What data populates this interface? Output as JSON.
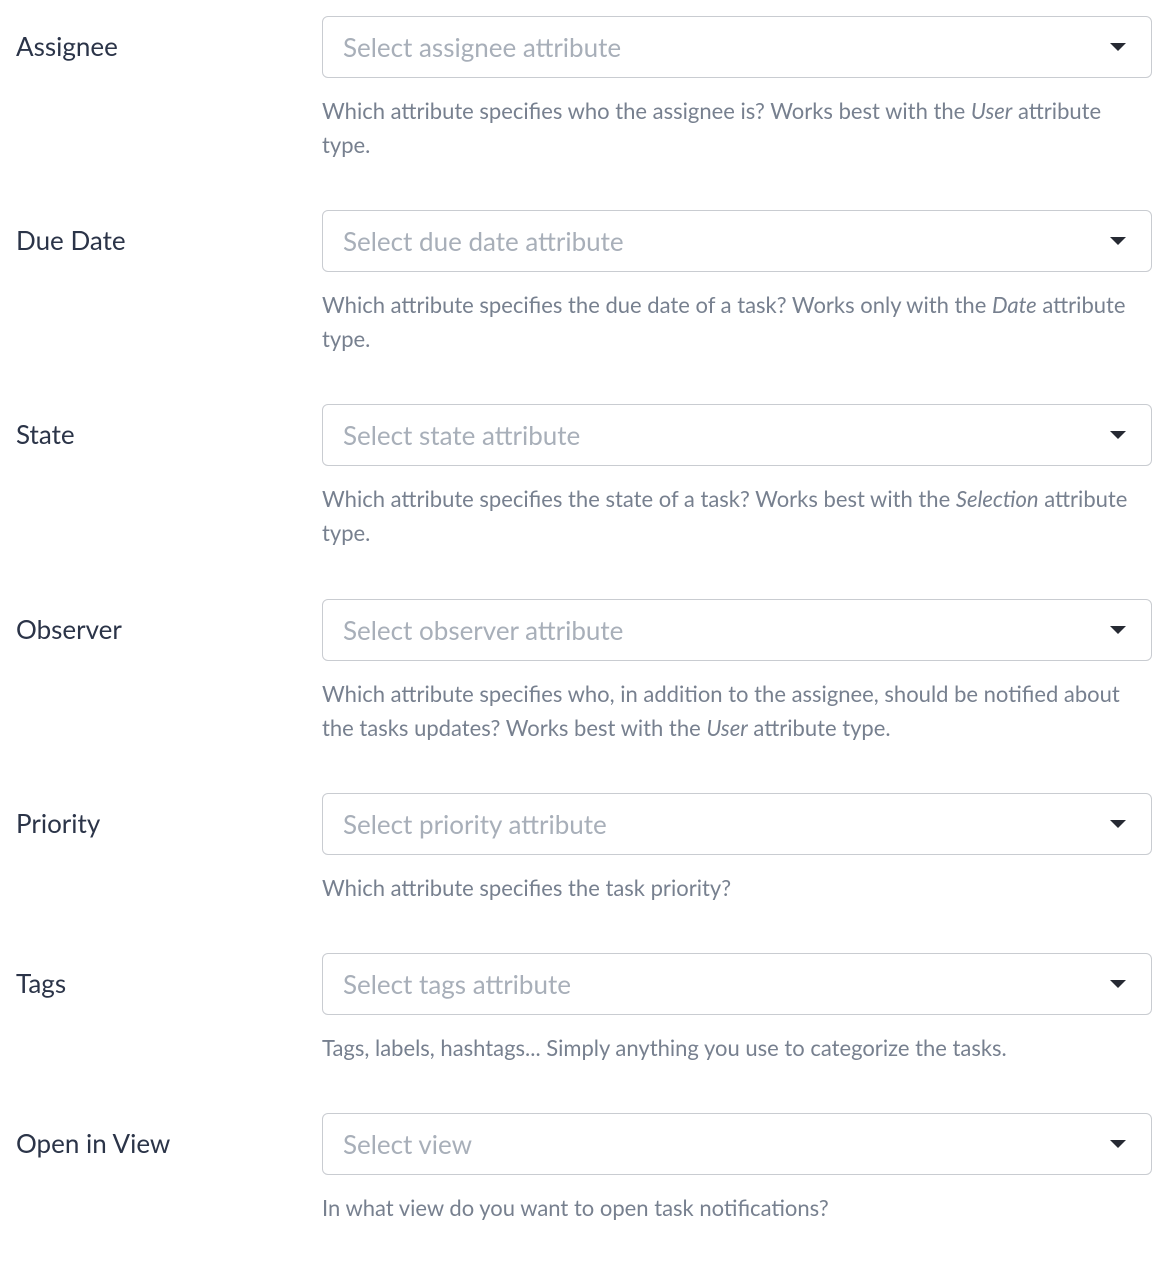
{
  "fields": {
    "assignee": {
      "label": "Assignee",
      "placeholder": "Select assignee attribute",
      "hint_pre": "Which attribute specifies who the assignee is? Works best with the ",
      "hint_em": "User",
      "hint_post": " attribute type."
    },
    "duedate": {
      "label": "Due Date",
      "placeholder": "Select due date attribute",
      "hint_pre": "Which attribute specifies the due date of a task? Works only with the ",
      "hint_em": "Date",
      "hint_post": " attribute type."
    },
    "state": {
      "label": "State",
      "placeholder": "Select state attribute",
      "hint_pre": "Which attribute specifies the state of a task? Works best with the ",
      "hint_em": "Selection",
      "hint_post": " attribute type."
    },
    "observer": {
      "label": "Observer",
      "placeholder": "Select observer attribute",
      "hint_pre": "Which attribute specifies who, in addition to the assignee, should be notified about the tasks updates? Works best with the ",
      "hint_em": "User",
      "hint_post": " attribute type."
    },
    "priority": {
      "label": "Priority",
      "placeholder": "Select priority attribute",
      "hint_pre": "Which attribute specifies the task priority?",
      "hint_em": "",
      "hint_post": ""
    },
    "tags": {
      "label": "Tags",
      "placeholder": "Select tags attribute",
      "hint_pre": "Tags, labels, hashtags... Simply anything you use to categorize the tasks.",
      "hint_em": "",
      "hint_post": ""
    },
    "openinview": {
      "label": "Open in View",
      "placeholder": "Select view",
      "hint_pre": "In what view do you want to open task notifications?",
      "hint_em": "",
      "hint_post": ""
    }
  }
}
